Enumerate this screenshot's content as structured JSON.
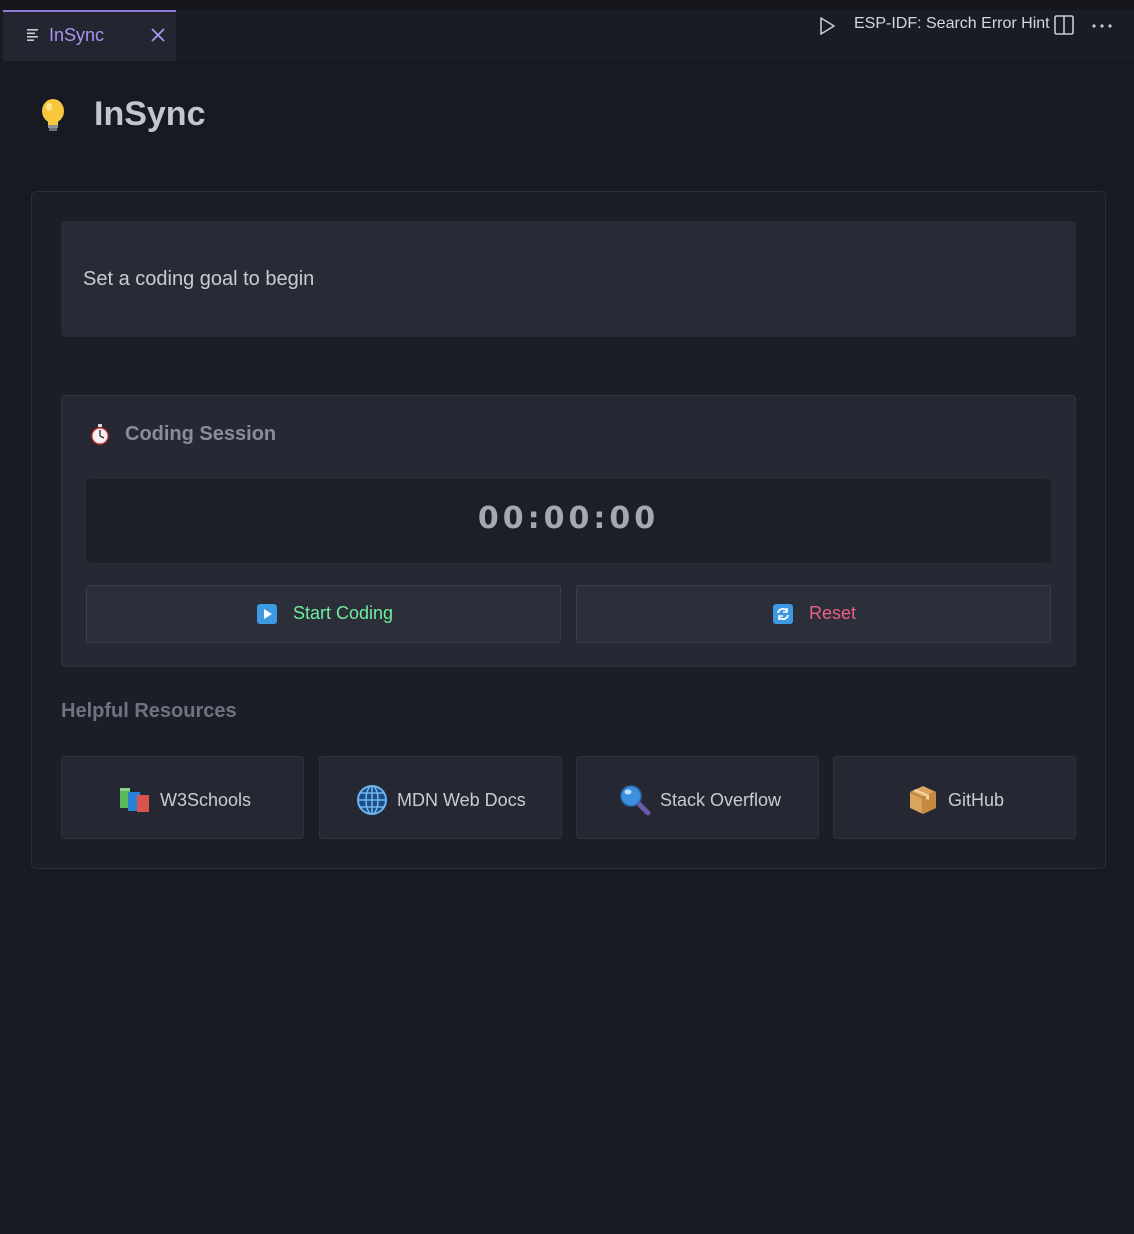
{
  "tab": {
    "label": "InSync"
  },
  "toolbar": {
    "command_label": "ESP-IDF: Search Error Hint"
  },
  "app": {
    "title": "InSync"
  },
  "goal": {
    "text": "Set a coding goal to begin"
  },
  "session": {
    "title": "Coding Session",
    "timer": "00:00:00",
    "start_label": "Start Coding",
    "reset_label": "Reset"
  },
  "resources": {
    "title": "Helpful Resources",
    "items": [
      {
        "label": "W3Schools",
        "icon": "books-icon"
      },
      {
        "label": "MDN Web Docs",
        "icon": "globe-icon"
      },
      {
        "label": "Stack Overflow",
        "icon": "magnifier-icon"
      },
      {
        "label": "GitHub",
        "icon": "package-icon"
      }
    ]
  },
  "colors": {
    "tab_accent": "#a896f0",
    "start": "#6cf09a",
    "reset": "#e86087",
    "background": "#181a22"
  }
}
